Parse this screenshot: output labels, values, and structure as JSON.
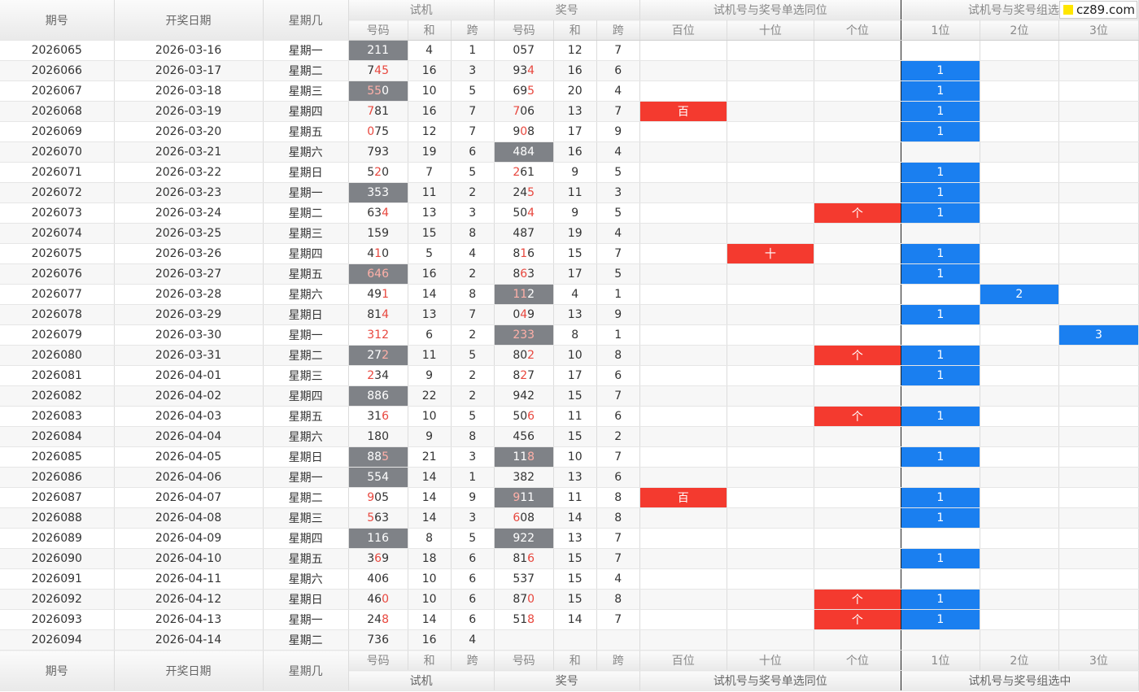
{
  "headers": {
    "issue": "期号",
    "date": "开奖日期",
    "weekday": "星期几",
    "trial": "试机",
    "prize": "奖号",
    "single_same": "试机号与奖号单选同位",
    "group_select": "试机号与奖号组选中",
    "group_select_clipped": "试机号与奖号组选",
    "code": "号码",
    "sum": "和",
    "span": "跨",
    "hundreds": "百位",
    "tens": "十位",
    "ones": "个位",
    "pos1": "1位",
    "pos2": "2位",
    "pos3": "3位"
  },
  "watermark": "cz89.com",
  "rows": [
    {
      "issue": "2026065",
      "date": "2026-03-16",
      "weekday": "星期一",
      "trial": "211",
      "trial_hl": [],
      "trial_grey": true,
      "tsum": "4",
      "tspan": "1",
      "prize": "057",
      "prize_hl": [],
      "prize_grey": false,
      "psum": "12",
      "pspan": "7",
      "single": "",
      "single_label": "",
      "group": "",
      "group_label": ""
    },
    {
      "issue": "2026066",
      "date": "2026-03-17",
      "weekday": "星期二",
      "trial": "745",
      "trial_hl": [
        1,
        2
      ],
      "trial_grey": false,
      "tsum": "16",
      "tspan": "3",
      "prize": "934",
      "prize_hl": [
        2
      ],
      "prize_grey": false,
      "psum": "16",
      "pspan": "6",
      "single": "",
      "single_label": "",
      "group": "1",
      "group_label": "1"
    },
    {
      "issue": "2026067",
      "date": "2026-03-18",
      "weekday": "星期三",
      "trial": "550",
      "trial_hl": [
        0,
        1
      ],
      "trial_grey": true,
      "tsum": "10",
      "tspan": "5",
      "prize": "695",
      "prize_hl": [
        2
      ],
      "prize_grey": false,
      "psum": "20",
      "pspan": "4",
      "single": "",
      "single_label": "",
      "group": "1",
      "group_label": "1"
    },
    {
      "issue": "2026068",
      "date": "2026-03-19",
      "weekday": "星期四",
      "trial": "781",
      "trial_hl": [
        0
      ],
      "trial_grey": false,
      "tsum": "16",
      "tspan": "7",
      "prize": "706",
      "prize_hl": [
        0
      ],
      "prize_grey": false,
      "psum": "13",
      "pspan": "7",
      "single": "hundreds",
      "single_label": "百",
      "group": "1",
      "group_label": "1"
    },
    {
      "issue": "2026069",
      "date": "2026-03-20",
      "weekday": "星期五",
      "trial": "075",
      "trial_hl": [
        0
      ],
      "trial_grey": false,
      "tsum": "12",
      "tspan": "7",
      "prize": "908",
      "prize_hl": [
        1
      ],
      "prize_grey": false,
      "psum": "17",
      "pspan": "9",
      "single": "",
      "single_label": "",
      "group": "1",
      "group_label": "1"
    },
    {
      "issue": "2026070",
      "date": "2026-03-21",
      "weekday": "星期六",
      "trial": "793",
      "trial_hl": [],
      "trial_grey": false,
      "tsum": "19",
      "tspan": "6",
      "prize": "484",
      "prize_hl": [],
      "prize_grey": true,
      "psum": "16",
      "pspan": "4",
      "single": "",
      "single_label": "",
      "group": "",
      "group_label": ""
    },
    {
      "issue": "2026071",
      "date": "2026-03-22",
      "weekday": "星期日",
      "trial": "520",
      "trial_hl": [
        1
      ],
      "trial_grey": false,
      "tsum": "7",
      "tspan": "5",
      "prize": "261",
      "prize_hl": [
        0
      ],
      "prize_grey": false,
      "psum": "9",
      "pspan": "5",
      "single": "",
      "single_label": "",
      "group": "1",
      "group_label": "1"
    },
    {
      "issue": "2026072",
      "date": "2026-03-23",
      "weekday": "星期一",
      "trial": "353",
      "trial_hl": [],
      "trial_grey": true,
      "tsum": "11",
      "tspan": "2",
      "prize": "245",
      "prize_hl": [
        2
      ],
      "prize_grey": false,
      "psum": "11",
      "pspan": "3",
      "single": "",
      "single_label": "",
      "group": "1",
      "group_label": "1"
    },
    {
      "issue": "2026073",
      "date": "2026-03-24",
      "weekday": "星期二",
      "trial": "634",
      "trial_hl": [
        2
      ],
      "trial_grey": false,
      "tsum": "13",
      "tspan": "3",
      "prize": "504",
      "prize_hl": [
        2
      ],
      "prize_grey": false,
      "psum": "9",
      "pspan": "5",
      "single": "ones",
      "single_label": "个",
      "group": "1",
      "group_label": "1"
    },
    {
      "issue": "2026074",
      "date": "2026-03-25",
      "weekday": "星期三",
      "trial": "159",
      "trial_hl": [],
      "trial_grey": false,
      "tsum": "15",
      "tspan": "8",
      "prize": "487",
      "prize_hl": [],
      "prize_grey": false,
      "psum": "19",
      "pspan": "4",
      "single": "",
      "single_label": "",
      "group": "",
      "group_label": ""
    },
    {
      "issue": "2026075",
      "date": "2026-03-26",
      "weekday": "星期四",
      "trial": "410",
      "trial_hl": [
        1
      ],
      "trial_grey": false,
      "tsum": "5",
      "tspan": "4",
      "prize": "816",
      "prize_hl": [
        1
      ],
      "prize_grey": false,
      "psum": "15",
      "pspan": "7",
      "single": "tens",
      "single_label": "十",
      "group": "1",
      "group_label": "1"
    },
    {
      "issue": "2026076",
      "date": "2026-03-27",
      "weekday": "星期五",
      "trial": "646",
      "trial_hl": [
        0,
        1,
        2
      ],
      "trial_grey": true,
      "tsum": "16",
      "tspan": "2",
      "prize": "863",
      "prize_hl": [
        1
      ],
      "prize_grey": false,
      "psum": "17",
      "pspan": "5",
      "single": "",
      "single_label": "",
      "group": "1",
      "group_label": "1"
    },
    {
      "issue": "2026077",
      "date": "2026-03-28",
      "weekday": "星期六",
      "trial": "491",
      "trial_hl": [
        2
      ],
      "trial_grey": false,
      "tsum": "14",
      "tspan": "8",
      "prize": "112",
      "prize_hl": [
        0,
        1
      ],
      "prize_grey": true,
      "psum": "4",
      "pspan": "1",
      "single": "",
      "single_label": "",
      "group": "2",
      "group_label": "2"
    },
    {
      "issue": "2026078",
      "date": "2026-03-29",
      "weekday": "星期日",
      "trial": "814",
      "trial_hl": [
        2
      ],
      "trial_grey": false,
      "tsum": "13",
      "tspan": "7",
      "prize": "049",
      "prize_hl": [
        1
      ],
      "prize_grey": false,
      "psum": "13",
      "pspan": "9",
      "single": "",
      "single_label": "",
      "group": "1",
      "group_label": "1"
    },
    {
      "issue": "2026079",
      "date": "2026-03-30",
      "weekday": "星期一",
      "trial": "312",
      "trial_hl": [
        0,
        1,
        2
      ],
      "trial_grey": false,
      "tsum": "6",
      "tspan": "2",
      "prize": "233",
      "prize_hl": [
        0,
        1,
        2
      ],
      "prize_grey": true,
      "psum": "8",
      "pspan": "1",
      "single": "",
      "single_label": "",
      "group": "3",
      "group_label": "3"
    },
    {
      "issue": "2026080",
      "date": "2026-03-31",
      "weekday": "星期二",
      "trial": "272",
      "trial_hl": [
        2
      ],
      "trial_grey": true,
      "tsum": "11",
      "tspan": "5",
      "prize": "802",
      "prize_hl": [
        2
      ],
      "prize_grey": false,
      "psum": "10",
      "pspan": "8",
      "single": "ones",
      "single_label": "个",
      "group": "1",
      "group_label": "1"
    },
    {
      "issue": "2026081",
      "date": "2026-04-01",
      "weekday": "星期三",
      "trial": "234",
      "trial_hl": [
        0
      ],
      "trial_grey": false,
      "tsum": "9",
      "tspan": "2",
      "prize": "827",
      "prize_hl": [
        1
      ],
      "prize_grey": false,
      "psum": "17",
      "pspan": "6",
      "single": "",
      "single_label": "",
      "group": "1",
      "group_label": "1"
    },
    {
      "issue": "2026082",
      "date": "2026-04-02",
      "weekday": "星期四",
      "trial": "886",
      "trial_hl": [],
      "trial_grey": true,
      "tsum": "22",
      "tspan": "2",
      "prize": "942",
      "prize_hl": [],
      "prize_grey": false,
      "psum": "15",
      "pspan": "7",
      "single": "",
      "single_label": "",
      "group": "",
      "group_label": ""
    },
    {
      "issue": "2026083",
      "date": "2026-04-03",
      "weekday": "星期五",
      "trial": "316",
      "trial_hl": [
        2
      ],
      "trial_grey": false,
      "tsum": "10",
      "tspan": "5",
      "prize": "506",
      "prize_hl": [
        2
      ],
      "prize_grey": false,
      "psum": "11",
      "pspan": "6",
      "single": "ones",
      "single_label": "个",
      "group": "1",
      "group_label": "1"
    },
    {
      "issue": "2026084",
      "date": "2026-04-04",
      "weekday": "星期六",
      "trial": "180",
      "trial_hl": [],
      "trial_grey": false,
      "tsum": "9",
      "tspan": "8",
      "prize": "456",
      "prize_hl": [],
      "prize_grey": false,
      "psum": "15",
      "pspan": "2",
      "single": "",
      "single_label": "",
      "group": "",
      "group_label": ""
    },
    {
      "issue": "2026085",
      "date": "2026-04-05",
      "weekday": "星期日",
      "trial": "885",
      "trial_hl": [
        2
      ],
      "trial_grey": true,
      "tsum": "21",
      "tspan": "3",
      "prize": "118",
      "prize_hl": [
        2
      ],
      "prize_grey": true,
      "psum": "10",
      "pspan": "7",
      "single": "",
      "single_label": "",
      "group": "1",
      "group_label": "1"
    },
    {
      "issue": "2026086",
      "date": "2026-04-06",
      "weekday": "星期一",
      "trial": "554",
      "trial_hl": [],
      "trial_grey": true,
      "tsum": "14",
      "tspan": "1",
      "prize": "382",
      "prize_hl": [],
      "prize_grey": false,
      "psum": "13",
      "pspan": "6",
      "single": "",
      "single_label": "",
      "group": "",
      "group_label": ""
    },
    {
      "issue": "2026087",
      "date": "2026-04-07",
      "weekday": "星期二",
      "trial": "905",
      "trial_hl": [
        0
      ],
      "trial_grey": false,
      "tsum": "14",
      "tspan": "9",
      "prize": "911",
      "prize_hl": [
        0
      ],
      "prize_grey": true,
      "psum": "11",
      "pspan": "8",
      "single": "hundreds",
      "single_label": "百",
      "group": "1",
      "group_label": "1"
    },
    {
      "issue": "2026088",
      "date": "2026-04-08",
      "weekday": "星期三",
      "trial": "563",
      "trial_hl": [
        0
      ],
      "trial_grey": false,
      "tsum": "14",
      "tspan": "3",
      "prize": "608",
      "prize_hl": [
        0
      ],
      "prize_grey": false,
      "psum": "14",
      "pspan": "8",
      "single": "",
      "single_label": "",
      "group": "1",
      "group_label": "1"
    },
    {
      "issue": "2026089",
      "date": "2026-04-09",
      "weekday": "星期四",
      "trial": "116",
      "trial_hl": [],
      "trial_grey": true,
      "tsum": "8",
      "tspan": "5",
      "prize": "922",
      "prize_hl": [],
      "prize_grey": true,
      "psum": "13",
      "pspan": "7",
      "single": "",
      "single_label": "",
      "group": "",
      "group_label": ""
    },
    {
      "issue": "2026090",
      "date": "2026-04-10",
      "weekday": "星期五",
      "trial": "369",
      "trial_hl": [
        1
      ],
      "trial_grey": false,
      "tsum": "18",
      "tspan": "6",
      "prize": "816",
      "prize_hl": [
        2
      ],
      "prize_grey": false,
      "psum": "15",
      "pspan": "7",
      "single": "",
      "single_label": "",
      "group": "1",
      "group_label": "1"
    },
    {
      "issue": "2026091",
      "date": "2026-04-11",
      "weekday": "星期六",
      "trial": "406",
      "trial_hl": [],
      "trial_grey": false,
      "tsum": "10",
      "tspan": "6",
      "prize": "537",
      "prize_hl": [],
      "prize_grey": false,
      "psum": "15",
      "pspan": "4",
      "single": "",
      "single_label": "",
      "group": "",
      "group_label": ""
    },
    {
      "issue": "2026092",
      "date": "2026-04-12",
      "weekday": "星期日",
      "trial": "460",
      "trial_hl": [
        2
      ],
      "trial_grey": false,
      "tsum": "10",
      "tspan": "6",
      "prize": "870",
      "prize_hl": [
        2
      ],
      "prize_grey": false,
      "psum": "15",
      "pspan": "8",
      "single": "ones",
      "single_label": "个",
      "group": "1",
      "group_label": "1"
    },
    {
      "issue": "2026093",
      "date": "2026-04-13",
      "weekday": "星期一",
      "trial": "248",
      "trial_hl": [
        2
      ],
      "trial_grey": false,
      "tsum": "14",
      "tspan": "6",
      "prize": "518",
      "prize_hl": [
        2
      ],
      "prize_grey": false,
      "psum": "14",
      "pspan": "7",
      "single": "ones",
      "single_label": "个",
      "group": "1",
      "group_label": "1"
    },
    {
      "issue": "2026094",
      "date": "2026-04-14",
      "weekday": "星期二",
      "trial": "736",
      "trial_hl": [],
      "trial_grey": false,
      "tsum": "16",
      "tspan": "4",
      "prize": "",
      "prize_hl": [],
      "prize_grey": false,
      "psum": "",
      "pspan": "",
      "single": "",
      "single_label": "",
      "group": "",
      "group_label": ""
    }
  ],
  "colors": {
    "red_mark": "#f43a2f",
    "blue_mark": "#1a7ff0",
    "grey_mark": "#7f8287",
    "highlight_digit": "#e8473e"
  }
}
